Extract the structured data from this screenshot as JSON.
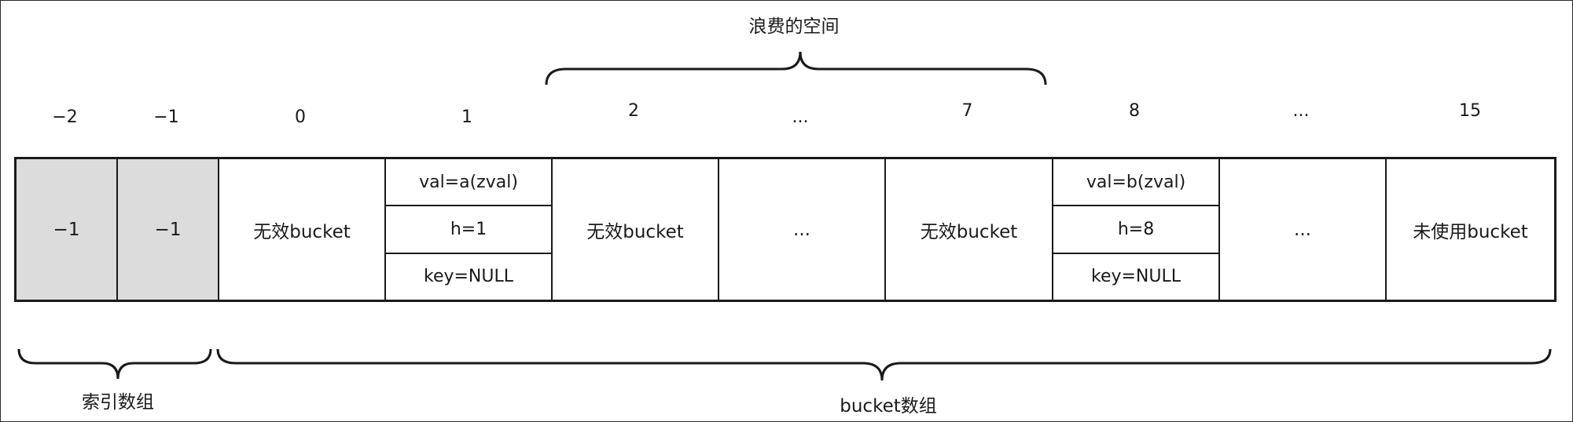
{
  "top_label": "浪费的空间",
  "indices": [
    "−2",
    "−1",
    "0",
    "1",
    "2",
    "...",
    "7",
    "8",
    "...",
    "15"
  ],
  "cells": [
    {
      "text": "−1",
      "shaded": true
    },
    {
      "text": "−1",
      "shaded": true
    },
    {
      "text": "无效bucket"
    },
    {
      "rows": [
        "val=a(zval)",
        "h=1",
        "key=NULL"
      ]
    },
    {
      "text": "无效bucket"
    },
    {
      "text": "..."
    },
    {
      "text": "无效bucket"
    },
    {
      "rows": [
        "val=b(zval)",
        "h=8",
        "key=NULL"
      ]
    },
    {
      "text": "..."
    },
    {
      "text": "未使用bucket"
    }
  ],
  "bottom_labels": {
    "index_array": "索引数组",
    "bucket_array": "bucket数组"
  },
  "colors": {
    "line": "#1a1a1a",
    "shaded_cell": "#dcdcdc",
    "background": "#ffffff"
  }
}
